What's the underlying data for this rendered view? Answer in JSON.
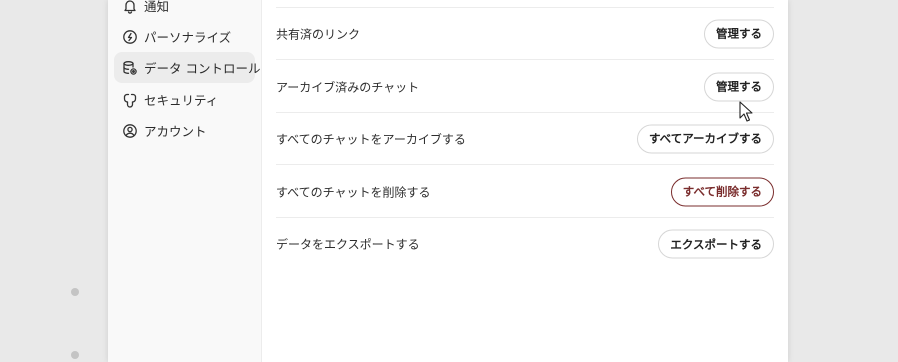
{
  "sidebar": {
    "items": [
      {
        "label": "通知",
        "icon": "bell-icon"
      },
      {
        "label": "パーソナライズ",
        "icon": "personalize-icon"
      },
      {
        "label": "データ コントロール",
        "icon": "data-control-icon",
        "active": true
      },
      {
        "label": "セキュリティ",
        "icon": "security-icon"
      },
      {
        "label": "アカウント",
        "icon": "account-icon"
      }
    ]
  },
  "data_controls": {
    "rows": [
      {
        "label": "共有済のリンク",
        "button": "管理する"
      },
      {
        "label": "アーカイブ済みのチャット",
        "button": "管理する"
      },
      {
        "label": "すべてのチャットをアーカイブする",
        "button": "すべてアーカイブする"
      },
      {
        "label": "すべてのチャットを削除する",
        "button": "すべて削除する",
        "danger": true
      },
      {
        "label": "データをエクスポートする",
        "button": "エクスポートする"
      }
    ]
  },
  "colors": {
    "danger": "#7a2d2d",
    "active_nav_bg": "#ececec",
    "sidebar_bg": "#f9f9f9"
  }
}
